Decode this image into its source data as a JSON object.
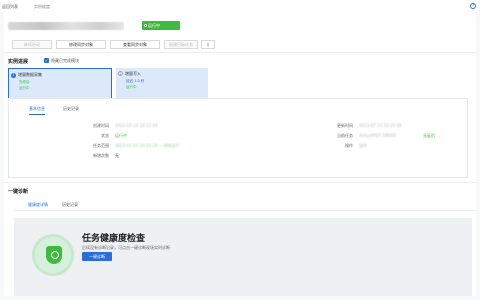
{
  "breadcrumb": [
    "返回列表",
    "实例维度"
  ],
  "header": {
    "status": "运行中"
  },
  "toolbar": {
    "buttons": [
      {
        "label": "继续启动",
        "disabled": true
      },
      {
        "label": "修改同步对象",
        "disabled": false
      },
      {
        "label": "查看同步对象",
        "disabled": false
      },
      {
        "label": "创建目标任务",
        "disabled": true
      }
    ],
    "more": "◊"
  },
  "progress": {
    "title": "实例进展",
    "checkbox_label": "隐藏已完成模块",
    "steps": [
      {
        "num": "1",
        "label": "增量数据采集",
        "sub1": "完成后",
        "sub2": "运行中"
      },
      {
        "num": "2",
        "label": "增量写入",
        "sub1": "延迟 1.0 秒",
        "sub2": "运行中"
      }
    ]
  },
  "detail": {
    "tabs": [
      "基本信息",
      "历史记录"
    ],
    "left": [
      {
        "label": "创建时间",
        "value": "2023-07-10 10:23:18"
      },
      {
        "label": "状态",
        "value": "运行中"
      },
      {
        "label": "任务范围",
        "value": "2023-07-10 10:23:18 ~ 持续运行"
      },
      {
        "label": "新增次数",
        "value": "无"
      }
    ],
    "right": [
      {
        "label": "更新时间",
        "value": "2023-07-10 10:23:18"
      },
      {
        "label": "当前任务",
        "value": "defaultPDT-1f8000",
        "suffix": "无延迟"
      },
      {
        "label": "操作",
        "value": "暂停"
      }
    ]
  },
  "diagnose": {
    "title": "一键诊断",
    "tabs": [
      "健康度详情",
      "历史记录"
    ],
    "heading": "任务健康度检查",
    "desc": "后续没有诊断记录，可点击一键诊断现场实时诊断",
    "button": "一键诊断"
  }
}
